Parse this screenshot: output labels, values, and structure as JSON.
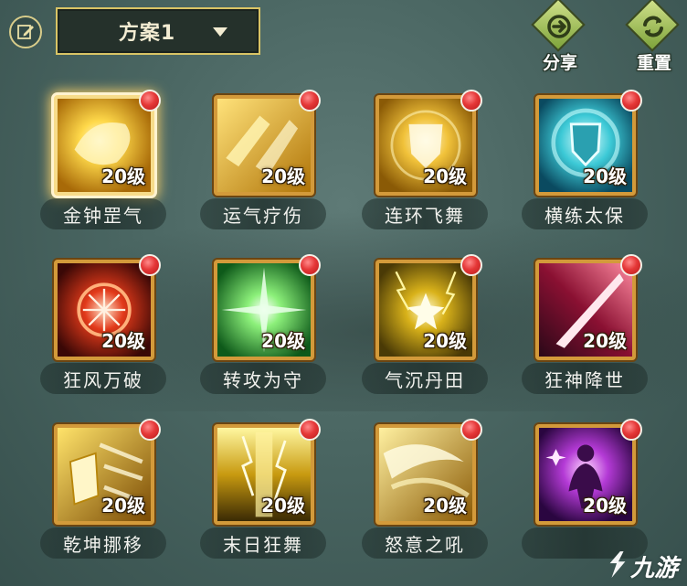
{
  "header": {
    "plan_selector": "方案1",
    "share_label": "分享",
    "reset_label": "重置"
  },
  "skills": [
    {
      "name": "金钟罡气",
      "level": "20级",
      "selected": true,
      "art": "golden-bell-art"
    },
    {
      "name": "运气疗伤",
      "level": "20级",
      "selected": false,
      "art": "heal-art"
    },
    {
      "name": "连环飞舞",
      "level": "20级",
      "selected": false,
      "art": "shield-glow-art"
    },
    {
      "name": "横练太保",
      "level": "20级",
      "selected": false,
      "art": "shield-swirl-art"
    },
    {
      "name": "狂风万破",
      "level": "20级",
      "selected": false,
      "art": "red-burst-art"
    },
    {
      "name": "转攻为守",
      "level": "20级",
      "selected": false,
      "art": "green-burst-art"
    },
    {
      "name": "气沉丹田",
      "level": "20级",
      "selected": false,
      "art": "lightning-star-art"
    },
    {
      "name": "狂神降世",
      "level": "20级",
      "selected": false,
      "art": "crimson-blade-art"
    },
    {
      "name": "乾坤挪移",
      "level": "20级",
      "selected": false,
      "art": "shield-slash-art"
    },
    {
      "name": "末日狂舞",
      "level": "20级",
      "selected": false,
      "art": "lightning-pillar-art"
    },
    {
      "name": "怒意之吼",
      "level": "20级",
      "selected": false,
      "art": "gold-wave-art"
    },
    {
      "name": "",
      "level": "20级",
      "selected": false,
      "art": "purple-figure-art"
    }
  ],
  "watermark": {
    "text": "九游"
  },
  "colors": {
    "frame_gold": "#d39a3a",
    "badge_red": "#e53838",
    "action_green": "#9cc04e",
    "selector_border": "#d9c465"
  }
}
